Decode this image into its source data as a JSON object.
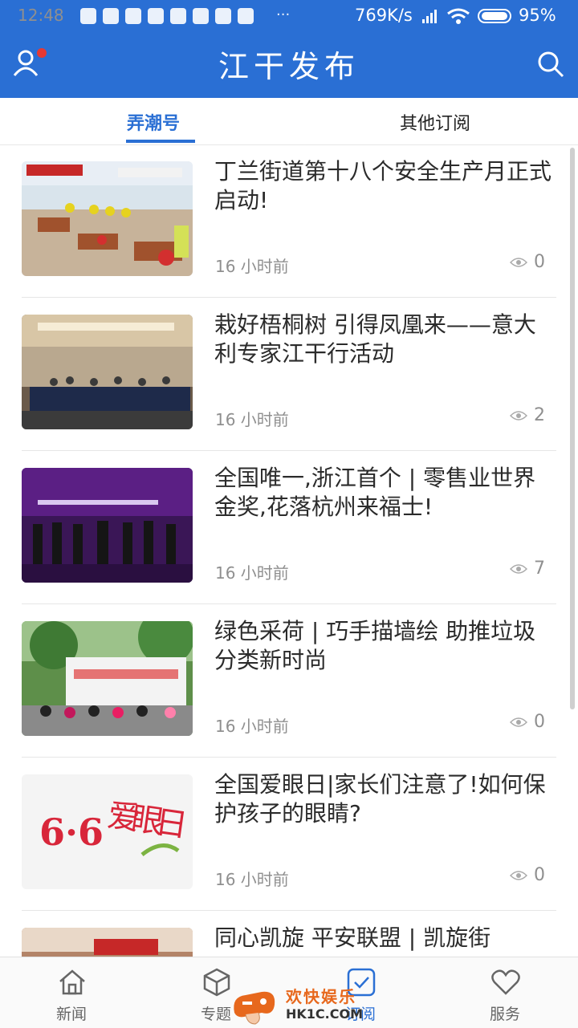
{
  "status_bar": {
    "time": "12:48",
    "network_speed": "769K/s",
    "battery": "95%"
  },
  "header": {
    "title": "江干发布",
    "left_icon": "user-icon",
    "right_icon": "search-icon",
    "accent_color": "#2a6fd4"
  },
  "tabs": [
    {
      "label": "弄潮号",
      "active": true
    },
    {
      "label": "其他订阅",
      "active": false
    }
  ],
  "articles": [
    {
      "title": "丁兰街道第十八个安全生产月正式启动!",
      "time": "16 小时前",
      "views": "0"
    },
    {
      "title": "栽好梧桐树 引得凤凰来——意大利专家江干行活动",
      "time": "16 小时前",
      "views": "2"
    },
    {
      "title": "全国唯一,浙江首个 | 零售业世界金奖,花落杭州来福士!",
      "time": "16 小时前",
      "views": "7"
    },
    {
      "title": "绿色采荷 | 巧手描墙绘 助推垃圾分类新时尚",
      "time": "16 小时前",
      "views": "0"
    },
    {
      "title": "全国爱眼日|家长们注意了!如何保护孩子的眼睛?",
      "time": "16 小时前",
      "views": "0"
    },
    {
      "title": "同心凯旋 平安联盟 | 凯旋街",
      "time": "",
      "views": ""
    }
  ],
  "thumb_texts": {
    "eye_day_num": "6·6",
    "eye_day_text": "爱眼日"
  },
  "bottom_nav": [
    {
      "label": "新闻",
      "icon": "home-icon",
      "active": false
    },
    {
      "label": "专题",
      "icon": "cube-icon",
      "active": false
    },
    {
      "label": "订阅",
      "icon": "check-box-icon",
      "active": true
    },
    {
      "label": "服务",
      "icon": "heart-icon",
      "active": false
    }
  ],
  "watermark": {
    "line1": "欢快娱乐",
    "line2": "HK1C.COM"
  }
}
